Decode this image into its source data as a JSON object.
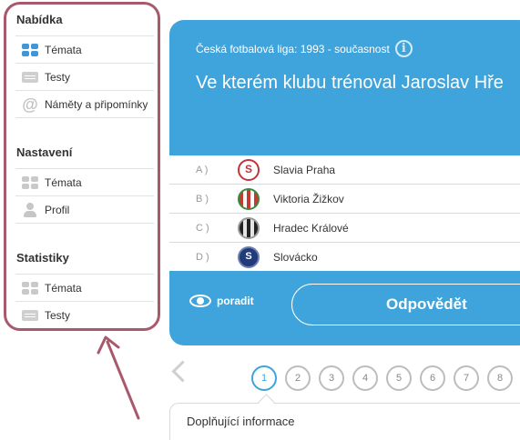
{
  "sidebar": {
    "menu": {
      "title": "Nabídka",
      "items": [
        {
          "label": "Témata",
          "icon": "grid-icon"
        },
        {
          "label": "Testy",
          "icon": "list-icon"
        },
        {
          "label": "Náměty a připomínky",
          "icon": "at-icon"
        }
      ]
    },
    "settings": {
      "title": "Nastavení",
      "items": [
        {
          "label": "Témata",
          "icon": "grid-icon"
        },
        {
          "label": "Profil",
          "icon": "person-icon"
        }
      ]
    },
    "stats": {
      "title": "Statistiky",
      "items": [
        {
          "label": "Témata",
          "icon": "grid-icon"
        },
        {
          "label": "Testy",
          "icon": "list-icon"
        }
      ]
    }
  },
  "question": {
    "category": "Česká fotbalová liga: 1993 - současnost",
    "text": "Ve kterém klubu trénoval Jaroslav Hře",
    "answers": [
      {
        "letter": "A )",
        "label": "Slavia Praha"
      },
      {
        "letter": "B )",
        "label": "Viktoria Žižkov"
      },
      {
        "letter": "C )",
        "label": "Hradec Králové"
      },
      {
        "letter": "D )",
        "label": "Slovácko"
      }
    ],
    "hint_label": "poradit",
    "answer_button": "Odpovědět"
  },
  "pagination": {
    "pages": [
      "1",
      "2",
      "3",
      "4",
      "5",
      "6",
      "7",
      "8"
    ],
    "active": "1"
  },
  "extra_info": "Doplňující informace",
  "colors": {
    "accent": "#3fa4db",
    "highlight_border": "#a85a6c",
    "arrow": "#a85a6c"
  }
}
